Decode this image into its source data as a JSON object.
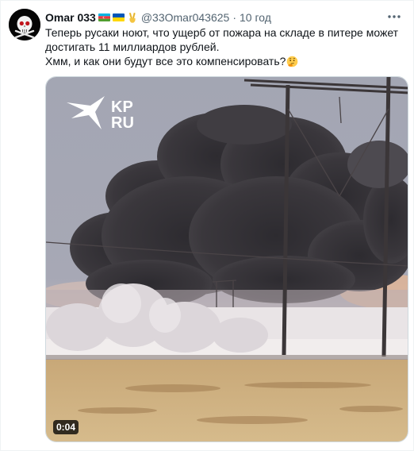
{
  "tweet": {
    "author_name": "Omar 033",
    "author_badges": [
      "azerbaijan-flag",
      "ukraine-flag",
      "victory-hand"
    ],
    "handle": "@33Omar043625",
    "separator": "·",
    "timestamp": "10 год",
    "text_line1": "Теперь русаки ноют, что ущерб от пожара на складе в питере может достигать 11 миллиардов рублей.",
    "text_line2": "Хмм, и как они будут все это компенсировать?",
    "text_emoji": "thinking-face",
    "media": {
      "type": "video",
      "duration": "0:04",
      "watermark": "KP RU",
      "watermark_line1": "KP",
      "watermark_line2": "RU"
    }
  },
  "colors": {
    "text_primary": "#0f1419",
    "text_secondary": "#536471",
    "border": "#cfd9de"
  }
}
